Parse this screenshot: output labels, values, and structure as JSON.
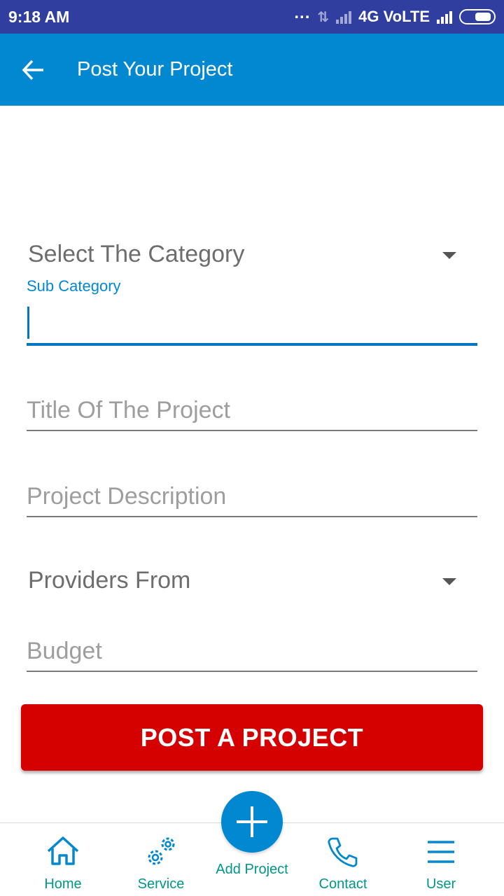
{
  "status_bar": {
    "time": "9:18 AM",
    "dots": "...",
    "network": "4G VoLTE"
  },
  "app_bar": {
    "back_icon": "arrow-left-icon",
    "title": "Post Your Project"
  },
  "form": {
    "category_spinner": "Select The Category",
    "sub_category_label": "Sub Category",
    "sub_category_value": "",
    "title_placeholder": "Title Of The Project",
    "description_placeholder": "Project Description",
    "providers_spinner": "Providers From",
    "budget_placeholder": "Budget",
    "submit_label": "POST A PROJECT"
  },
  "bottom_nav": {
    "items": [
      {
        "label": "Home",
        "icon": "home-icon"
      },
      {
        "label": "Service",
        "icon": "gears-icon"
      },
      {
        "label": "Add Project",
        "icon": "plus-icon"
      },
      {
        "label": "Contact",
        "icon": "phone-icon"
      },
      {
        "label": "User",
        "icon": "menu-icon"
      }
    ]
  },
  "colors": {
    "status_bar": "#303f9f",
    "app_bar": "#0288d1",
    "accent": "#0277bd",
    "post_button": "#d50000",
    "nav_label": "#009688"
  }
}
